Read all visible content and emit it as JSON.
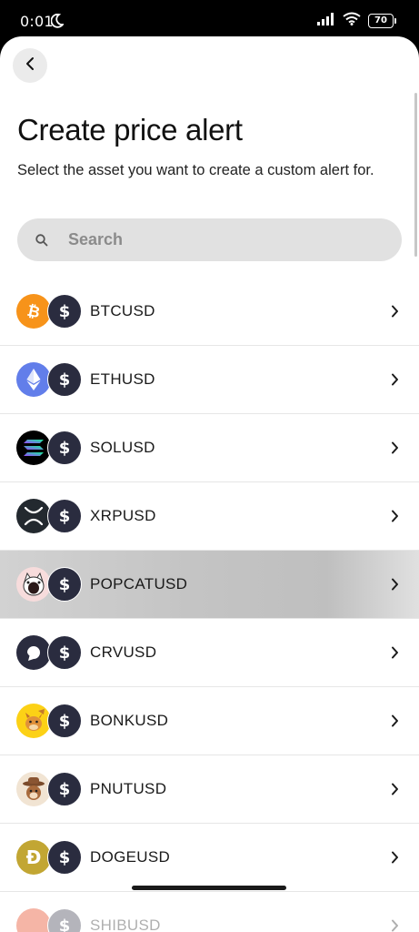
{
  "status_bar": {
    "time": "0:01",
    "battery": "70"
  },
  "header": {
    "title": "Create price alert",
    "subtitle": "Select the asset you want to create a custom alert for."
  },
  "search": {
    "placeholder": "Search",
    "value": ""
  },
  "assets": [
    {
      "symbol": "BTCUSD",
      "coin_icon": "bitcoin-icon",
      "coin_color": "#f7931a"
    },
    {
      "symbol": "ETHUSD",
      "coin_icon": "ethereum-icon",
      "coin_color": "#627eea"
    },
    {
      "symbol": "SOLUSD",
      "coin_icon": "solana-icon",
      "coin_color": "#000000"
    },
    {
      "symbol": "XRPUSD",
      "coin_icon": "xrp-icon",
      "coin_color": "#23292f"
    },
    {
      "symbol": "POPCATUSD",
      "coin_icon": "popcat-icon",
      "coin_color": "#f7dcdc"
    },
    {
      "symbol": "CRVUSD",
      "coin_icon": "curve-icon",
      "coin_color": "#2a2c3f"
    },
    {
      "symbol": "BONKUSD",
      "coin_icon": "bonk-icon",
      "coin_color": "#fcd116"
    },
    {
      "symbol": "PNUTUSD",
      "coin_icon": "pnut-icon",
      "coin_color": "#f1e4d3"
    },
    {
      "symbol": "DOGEUSD",
      "coin_icon": "dogecoin-icon",
      "coin_color": "#c2a633"
    },
    {
      "symbol": "SHIBUSD",
      "coin_icon": "shiba-icon",
      "coin_color": "#e42d04"
    }
  ],
  "usd_icon": "$",
  "doge_glyph": "Ð",
  "colors": {
    "sheet_background": "#ffffff",
    "search_background": "#e1e1e1",
    "usd_badge": "#2a2c3f",
    "pressed_row": "#c4c4c4"
  }
}
